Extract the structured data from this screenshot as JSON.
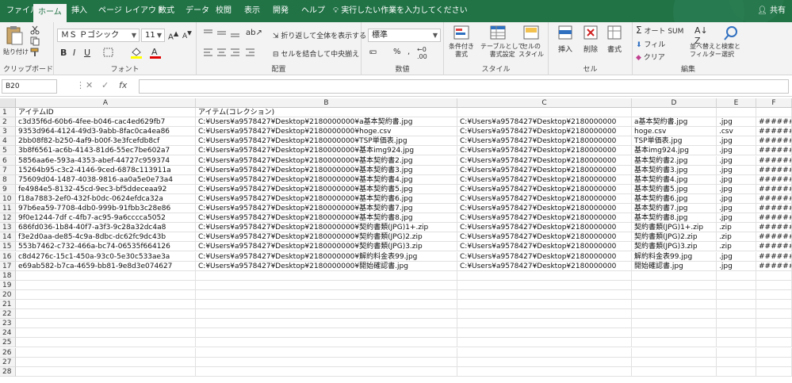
{
  "tabs": [
    "ファイル",
    "ホーム",
    "挿入",
    "ページ レイアウト",
    "数式",
    "データ",
    "校閲",
    "表示",
    "開発",
    "ヘルプ"
  ],
  "active_tab": "ホーム",
  "tell_me": "実行したい作業を入力してください",
  "share": "共有",
  "ribbon": {
    "clipboard": {
      "label": "クリップボード",
      "paste": "貼り付け"
    },
    "font": {
      "label": "フォント",
      "name": "ＭＳ Ｐゴシック",
      "size": "11"
    },
    "alignment": {
      "label": "配置",
      "wrap": "折り返して全体を表示する",
      "merge": "セルを結合して中央揃え"
    },
    "number": {
      "label": "数値",
      "format": "標準",
      "percent": "%",
      "comma": ","
    },
    "styles": {
      "label": "スタイル",
      "conditional": "条件付き\n書式",
      "table": "テーブルとして\n書式設定",
      "cell_styles": "セルの\nスタイル"
    },
    "cells": {
      "label": "セル",
      "insert": "挿入",
      "delete": "削除",
      "format": "書式"
    },
    "editing": {
      "label": "編集",
      "autosum": "オート SUM",
      "fill": "フィル",
      "clear": "クリア",
      "sort": "並べ替えと\nフィルター",
      "find": "検索と\n選択"
    }
  },
  "formula_bar": {
    "name_box": "B20",
    "cancel": "✕",
    "enter": "✓",
    "fx": "fx",
    "value": ""
  },
  "columns": [
    "A",
    "B",
    "C",
    "D",
    "E",
    "F"
  ],
  "rows": [
    [
      "アイテムID",
      "アイテム(コレクション)",
      "",
      "",
      "",
      ""
    ],
    [
      "c3d35f6d-60b6-4fee-b046-cac4ed629fb7",
      "C:¥Users¥a9578427¥Desktop¥2180000000¥a基本契約書.jpg",
      "C:¥Users¥a9578427¥Desktop¥2180000000",
      "a基本契約書.jpg",
      ".jpg",
      "#######"
    ],
    [
      "9353d964-4124-49d3-9abb-8fac0ca4ea86",
      "C:¥Users¥a9578427¥Desktop¥2180000000¥hoge.csv",
      "C:¥Users¥a9578427¥Desktop¥2180000000",
      "hoge.csv",
      ".csv",
      "#######"
    ],
    [
      "2bb08f82-b250-4af9-b00f-3e3fcefdb8cf",
      "C:¥Users¥a9578427¥Desktop¥2180000000¥TSP単価表.jpg",
      "C:¥Users¥a9578427¥Desktop¥2180000000",
      "TSP単価表.jpg",
      ".jpg",
      "#######"
    ],
    [
      "3b8f6561-ac6b-4143-81d6-55ec7be602a7",
      "C:¥Users¥a9578427¥Desktop¥2180000000¥基本img924.jpg",
      "C:¥Users¥a9578427¥Desktop¥2180000000",
      "基本img924.jpg",
      ".jpg",
      "#######"
    ],
    [
      "5856aa6e-593a-4353-abef-44727c959374",
      "C:¥Users¥a9578427¥Desktop¥2180000000¥基本契約書2.jpg",
      "C:¥Users¥a9578427¥Desktop¥2180000000",
      "基本契約書2.jpg",
      ".jpg",
      "#######"
    ],
    [
      "15264b95-c3c2-4146-9ced-6878c113911a",
      "C:¥Users¥a9578427¥Desktop¥2180000000¥基本契約書3.jpg",
      "C:¥Users¥a9578427¥Desktop¥2180000000",
      "基本契約書3.jpg",
      ".jpg",
      "#######"
    ],
    [
      "75609d04-1487-4038-9816-aa0a5e0e73a4",
      "C:¥Users¥a9578427¥Desktop¥2180000000¥基本契約書4.jpg",
      "C:¥Users¥a9578427¥Desktop¥2180000000",
      "基本契約書4.jpg",
      ".jpg",
      "#######"
    ],
    [
      "fe4984e5-8132-45cd-9ec3-bf5ddeceaa92",
      "C:¥Users¥a9578427¥Desktop¥2180000000¥基本契約書5.jpg",
      "C:¥Users¥a9578427¥Desktop¥2180000000",
      "基本契約書5.jpg",
      ".jpg",
      "#######"
    ],
    [
      "f18a7883-2ef0-432f-b0dc-0624efdca32a",
      "C:¥Users¥a9578427¥Desktop¥2180000000¥基本契約書6.jpg",
      "C:¥Users¥a9578427¥Desktop¥2180000000",
      "基本契約書6.jpg",
      ".jpg",
      "#######"
    ],
    [
      "97b6ea59-7708-4db0-999b-91fbb3c28e86",
      "C:¥Users¥a9578427¥Desktop¥2180000000¥基本契約書7.jpg",
      "C:¥Users¥a9578427¥Desktop¥2180000000",
      "基本契約書7.jpg",
      ".jpg",
      "#######"
    ],
    [
      "9f0e1244-7df c-4fb7-ac95-9a6cccca5052",
      "C:¥Users¥a9578427¥Desktop¥2180000000¥基本契約書8.jpg",
      "C:¥Users¥a9578427¥Desktop¥2180000000",
      "基本契約書8.jpg",
      ".jpg",
      "#######"
    ],
    [
      "686fd036-1b84-40f7-a3f3-9c28a32dc4a8",
      "C:¥Users¥a9578427¥Desktop¥2180000000¥契約書類(JPG)1+.zip",
      "C:¥Users¥a9578427¥Desktop¥2180000000",
      "契約書類(JPG)1+.zip",
      ".zip",
      "#######"
    ],
    [
      "f3e2d0aa-de85-4c9a-8dbc-dc62fc9dc43b",
      "C:¥Users¥a9578427¥Desktop¥2180000000¥契約書類(JPG)2.zip",
      "C:¥Users¥a9578427¥Desktop¥2180000000",
      "契約書類(JPG)2.zip",
      ".zip",
      "#######"
    ],
    [
      "553b7462-c732-466a-bc74-06535f664126",
      "C:¥Users¥a9578427¥Desktop¥2180000000¥契約書類(JPG)3.zip",
      "C:¥Users¥a9578427¥Desktop¥2180000000",
      "契約書類(JPG)3.zip",
      ".zip",
      "#######"
    ],
    [
      "c8d4276c-15c1-450a-93c0-5e30c533ae3a",
      "C:¥Users¥a9578427¥Desktop¥2180000000¥解約料金表99.jpg",
      "C:¥Users¥a9578427¥Desktop¥2180000000",
      "解約料金表99.jpg",
      ".jpg",
      "#######"
    ],
    [
      "e69ab582-b7ca-4659-bb81-9e8d3e074627",
      "C:¥Users¥a9578427¥Desktop¥2180000000¥開始確認書.jpg",
      "C:¥Users¥a9578427¥Desktop¥2180000000",
      "開始確認書.jpg",
      ".jpg",
      "#######"
    ],
    [
      "",
      "",
      "",
      "",
      "",
      ""
    ],
    [
      "",
      "",
      "",
      "",
      "",
      ""
    ],
    [
      "",
      "",
      "",
      "",
      "",
      ""
    ],
    [
      "",
      "",
      "",
      "",
      "",
      ""
    ],
    [
      "",
      "",
      "",
      "",
      "",
      ""
    ],
    [
      "",
      "",
      "",
      "",
      "",
      ""
    ],
    [
      "",
      "",
      "",
      "",
      "",
      ""
    ],
    [
      "",
      "",
      "",
      "",
      "",
      ""
    ],
    [
      "",
      "",
      "",
      "",
      "",
      ""
    ],
    [
      "",
      "",
      "",
      "",
      "",
      ""
    ],
    [
      "",
      "",
      "",
      "",
      "",
      ""
    ]
  ],
  "row_numbers": [
    "1",
    "2",
    "3",
    "4",
    "5",
    "6",
    "7",
    "8",
    "9",
    "10",
    "11",
    "12",
    "13",
    "14",
    "15",
    "16",
    "17",
    "18",
    "19",
    "20",
    "21",
    "22",
    "23",
    "24",
    "25",
    "26",
    "27",
    "28"
  ]
}
